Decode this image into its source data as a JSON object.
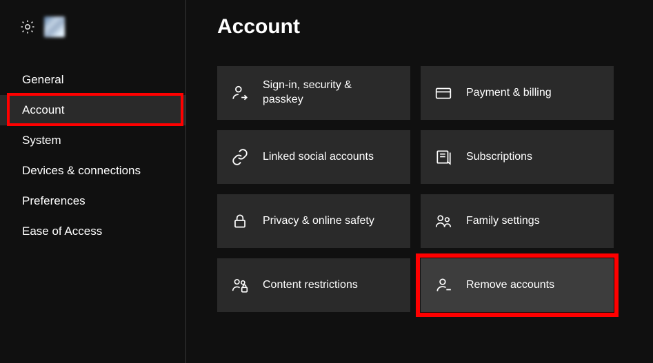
{
  "page": {
    "title": "Account"
  },
  "sidebar": {
    "items": [
      {
        "label": "General"
      },
      {
        "label": "Account"
      },
      {
        "label": "System"
      },
      {
        "label": "Devices & connections"
      },
      {
        "label": "Preferences"
      },
      {
        "label": "Ease of Access"
      }
    ],
    "selected_index": 1
  },
  "tiles": [
    {
      "icon": "person-signin-icon",
      "label": "Sign-in, security & passkey"
    },
    {
      "icon": "card-icon",
      "label": "Payment & billing"
    },
    {
      "icon": "link-icon",
      "label": "Linked social accounts"
    },
    {
      "icon": "receipt-icon",
      "label": "Subscriptions"
    },
    {
      "icon": "lock-icon",
      "label": "Privacy & online safety"
    },
    {
      "icon": "people-icon",
      "label": "Family settings"
    },
    {
      "icon": "people-lock-icon",
      "label": "Content restrictions"
    },
    {
      "icon": "person-remove-icon",
      "label": "Remove accounts"
    }
  ],
  "highlights": {
    "sidebar_item": 1,
    "tile": 7,
    "color": "#ff0000"
  }
}
